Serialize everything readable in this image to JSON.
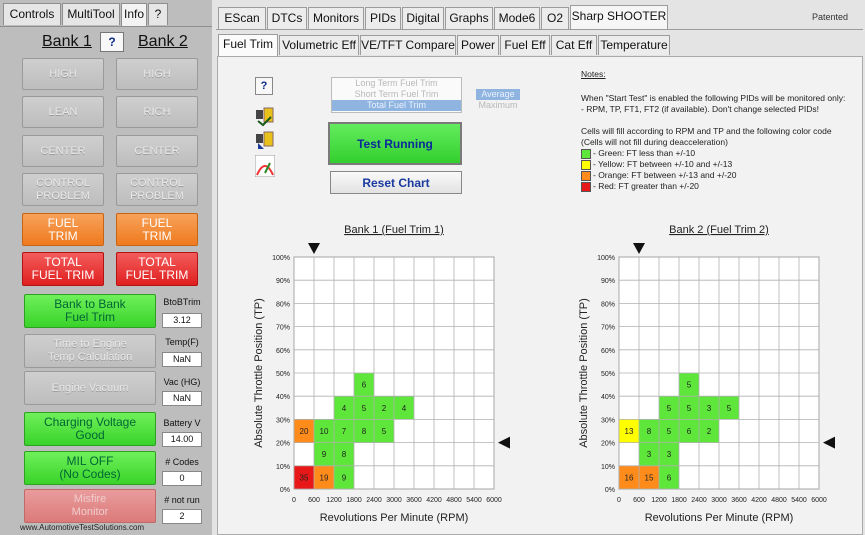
{
  "left_tabs": [
    "Controls",
    "MultiTool",
    "Info",
    "?"
  ],
  "bank1_label": "Bank 1",
  "bank2_label": "Bank 2",
  "help_label": "?",
  "left_buttons": {
    "high": "HIGH",
    "lean": "LEAN",
    "rich": "RICH",
    "center": "CENTER",
    "control": "CONTROL\nPROBLEM",
    "fuel_trim": "FUEL\nTRIM",
    "total_fuel_trim": "TOTAL\nFUEL TRIM",
    "bank_to_bank": "Bank to Bank\nFuel Trim",
    "time_to_engine": "Time to Engine\nTemp Calculation",
    "engine_vacuum": "Engine Vacuum",
    "charging_voltage": "Charging Voltage\nGood",
    "mil": "MIL OFF\n(No Codes)",
    "misfire": "Misfire\nMonitor"
  },
  "readouts": {
    "btob_label": "BtoBTrim",
    "btob_value": "3.12",
    "temp_label": "Temp(F)",
    "temp_value": "NaN",
    "vac_label": "Vac (HG)",
    "vac_value": "NaN",
    "battery_label": "Battery V",
    "battery_value": "14.00",
    "codes_label": "# Codes",
    "codes_value": "0",
    "notrun_label": "# not run",
    "notrun_value": "2"
  },
  "website": "www.AutomotiveTestSolutions.com",
  "top_tabs": [
    "EScan",
    "DTCs",
    "Monitors",
    "PIDs",
    "Digital",
    "Graphs",
    "Mode6",
    "O2",
    "Sharp SHOOTER"
  ],
  "patented": "Patented",
  "sub_tabs": [
    "Fuel Trim",
    "Volumetric Eff",
    "VE/TFT Compare",
    "Power",
    "Fuel Eff",
    "Cat Eff",
    "Temperature"
  ],
  "trim_options": [
    "Long Term Fuel Trim",
    "Short Term Fuel Trim",
    "Total Fuel Trim"
  ],
  "mode_options": [
    "Average",
    "Maximum"
  ],
  "test_button": "Test Running",
  "reset_button": "Reset Chart",
  "colors": {
    "green": "#5ee63a",
    "yellow": "#ffff00",
    "orange": "#ff8c1a",
    "red": "#e81818",
    "test_green": "#4ee04a"
  },
  "icons": [
    "help-icon",
    "graph-record-icon",
    "graph-play-icon",
    "gauge-icon"
  ],
  "notes": {
    "title": "Notes:",
    "line1": "When \"Start Test\" is enabled the following PIDs will be monitored only:",
    "line2": "- RPM, TP, FT1, FT2 (if available).  Don't change selected PIDs!",
    "line3": "Cells will fill according to RPM and TP and the following color code",
    "line4": "(Cells will not fill during deacceleration)",
    "legend": [
      {
        "color": "green",
        "label": "- Green:  FT less than +/-10"
      },
      {
        "color": "yellow",
        "label": "- Yellow:  FT between +/-10 and +/-13"
      },
      {
        "color": "orange",
        "label": "- Orange: FT between +/-13 and +/-20"
      },
      {
        "color": "red",
        "label": "- Red:      FT greater than +/-20"
      }
    ]
  },
  "chart_data": [
    {
      "type": "heatmap",
      "title": "Bank 1 (Fuel Trim 1)",
      "xlabel": "Revolutions Per Minute (RPM)",
      "ylabel": "Absolute Throttle Position (TP)",
      "x_ticks": [
        "0",
        "600",
        "1200",
        "1800",
        "2400",
        "3000",
        "3600",
        "4200",
        "4800",
        "5400",
        "6000"
      ],
      "y_ticks": [
        "0%",
        "10%",
        "20%",
        "30%",
        "40%",
        "50%",
        "60%",
        "70%",
        "80%",
        "90%",
        "100%"
      ],
      "rpm_marker": 600,
      "tp_marker": 20,
      "cells": [
        {
          "rpm": 0,
          "tp": 10,
          "value": 35,
          "color": "red"
        },
        {
          "rpm": 600,
          "tp": 10,
          "value": 19,
          "color": "orange"
        },
        {
          "rpm": 1200,
          "tp": 10,
          "value": 9,
          "color": "green"
        },
        {
          "rpm": 600,
          "tp": 20,
          "value": 9,
          "color": "green"
        },
        {
          "rpm": 1200,
          "tp": 20,
          "value": 8,
          "color": "green"
        },
        {
          "rpm": 0,
          "tp": 30,
          "value": 20,
          "color": "orange"
        },
        {
          "rpm": 600,
          "tp": 30,
          "value": 10,
          "color": "green"
        },
        {
          "rpm": 1200,
          "tp": 30,
          "value": 7,
          "color": "green"
        },
        {
          "rpm": 1800,
          "tp": 30,
          "value": 8,
          "color": "green"
        },
        {
          "rpm": 2400,
          "tp": 30,
          "value": 5,
          "color": "green"
        },
        {
          "rpm": 1200,
          "tp": 40,
          "value": 4,
          "color": "green"
        },
        {
          "rpm": 1800,
          "tp": 40,
          "value": 5,
          "color": "green"
        },
        {
          "rpm": 2400,
          "tp": 40,
          "value": 2,
          "color": "green"
        },
        {
          "rpm": 3000,
          "tp": 40,
          "value": 4,
          "color": "green"
        },
        {
          "rpm": 1800,
          "tp": 50,
          "value": 6,
          "color": "green"
        }
      ]
    },
    {
      "type": "heatmap",
      "title": "Bank 2 (Fuel Trim 2)",
      "xlabel": "Revolutions Per Minute (RPM)",
      "ylabel": "Absolute Throttle Position (TP)",
      "x_ticks": [
        "0",
        "600",
        "1200",
        "1800",
        "2400",
        "3000",
        "3600",
        "4200",
        "4800",
        "5400",
        "6000"
      ],
      "y_ticks": [
        "0%",
        "10%",
        "20%",
        "30%",
        "40%",
        "50%",
        "60%",
        "70%",
        "80%",
        "90%",
        "100%"
      ],
      "rpm_marker": 600,
      "tp_marker": 20,
      "cells": [
        {
          "rpm": 0,
          "tp": 10,
          "value": 16,
          "color": "orange"
        },
        {
          "rpm": 600,
          "tp": 10,
          "value": 15,
          "color": "orange"
        },
        {
          "rpm": 1200,
          "tp": 10,
          "value": 6,
          "color": "green"
        },
        {
          "rpm": 600,
          "tp": 20,
          "value": 3,
          "color": "green"
        },
        {
          "rpm": 1200,
          "tp": 20,
          "value": 3,
          "color": "green"
        },
        {
          "rpm": 0,
          "tp": 30,
          "value": 13,
          "color": "yellow"
        },
        {
          "rpm": 600,
          "tp": 30,
          "value": 8,
          "color": "green"
        },
        {
          "rpm": 1200,
          "tp": 30,
          "value": 5,
          "color": "green"
        },
        {
          "rpm": 1800,
          "tp": 30,
          "value": 6,
          "color": "green"
        },
        {
          "rpm": 2400,
          "tp": 30,
          "value": 2,
          "color": "green"
        },
        {
          "rpm": 1200,
          "tp": 40,
          "value": 5,
          "color": "green"
        },
        {
          "rpm": 1800,
          "tp": 40,
          "value": 5,
          "color": "green"
        },
        {
          "rpm": 2400,
          "tp": 40,
          "value": 3,
          "color": "green"
        },
        {
          "rpm": 3000,
          "tp": 40,
          "value": 5,
          "color": "green"
        },
        {
          "rpm": 1800,
          "tp": 50,
          "value": 5,
          "color": "green"
        }
      ]
    }
  ]
}
